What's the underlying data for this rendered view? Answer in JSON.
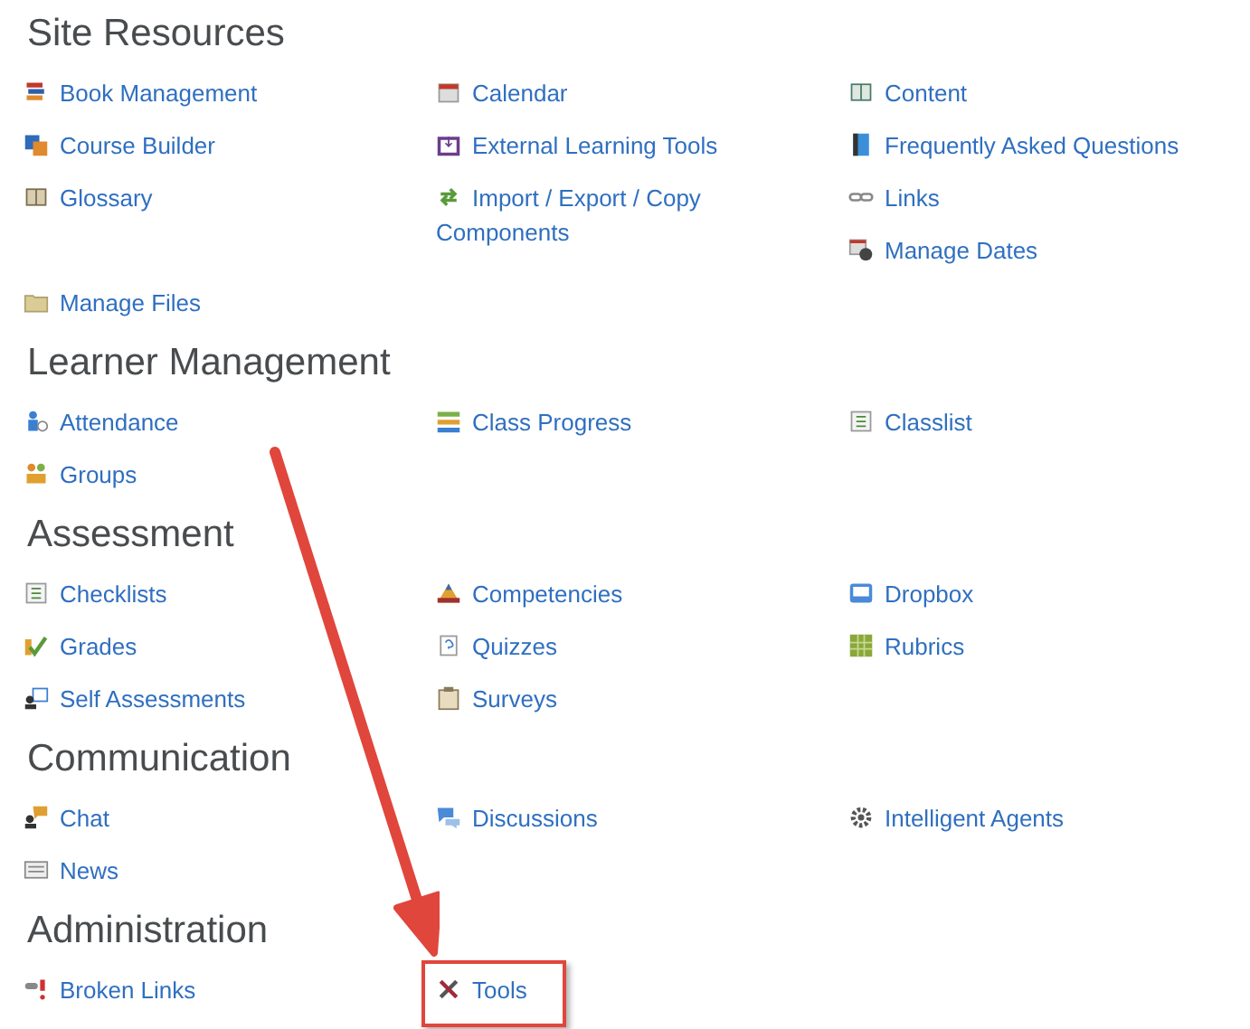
{
  "sections": [
    {
      "title": "Site Resources",
      "items": [
        {
          "label": "Book Management",
          "highlighted": false
        },
        {
          "label": "Calendar",
          "highlighted": false
        },
        {
          "label": "Content",
          "highlighted": false
        },
        {
          "label": "Course Builder",
          "highlighted": false
        },
        {
          "label": "External Learning Tools",
          "highlighted": false
        },
        {
          "label": "Frequently Asked Questions",
          "highlighted": false
        },
        {
          "label": "Glossary",
          "highlighted": false
        },
        {
          "label": "Import / Export / Copy Components",
          "highlighted": false
        },
        {
          "label": "Links",
          "highlighted": false
        },
        {
          "label": "Manage Dates",
          "highlighted": false
        },
        {
          "label": "Manage Files",
          "highlighted": false
        }
      ]
    },
    {
      "title": "Learner Management",
      "items": [
        {
          "label": "Attendance",
          "highlighted": false
        },
        {
          "label": "Class Progress",
          "highlighted": false
        },
        {
          "label": "Classlist",
          "highlighted": false
        },
        {
          "label": "Groups",
          "highlighted": false
        }
      ]
    },
    {
      "title": "Assessment",
      "items": [
        {
          "label": "Checklists",
          "highlighted": false
        },
        {
          "label": "Competencies",
          "highlighted": false
        },
        {
          "label": "Dropbox",
          "highlighted": false
        },
        {
          "label": "Grades",
          "highlighted": false
        },
        {
          "label": "Quizzes",
          "highlighted": false
        },
        {
          "label": "Rubrics",
          "highlighted": false
        },
        {
          "label": "Self Assessments",
          "highlighted": false
        },
        {
          "label": "Surveys",
          "highlighted": false
        }
      ]
    },
    {
      "title": "Communication",
      "items": [
        {
          "label": "Chat",
          "highlighted": false
        },
        {
          "label": "Discussions",
          "highlighted": false
        },
        {
          "label": "Intelligent Agents",
          "highlighted": false
        },
        {
          "label": "News",
          "highlighted": false
        }
      ]
    },
    {
      "title": "Administration",
      "items": [
        {
          "label": "Broken Links",
          "highlighted": false
        },
        {
          "label": "Tools",
          "highlighted": true
        }
      ]
    }
  ]
}
